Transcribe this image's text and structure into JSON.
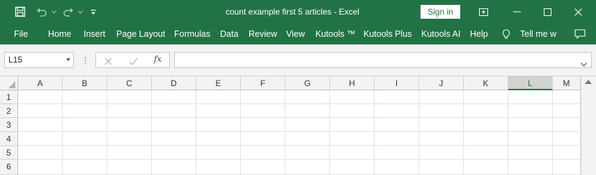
{
  "window": {
    "title": "count example first 5 articles  -  Excel",
    "sign_in_label": "Sign in",
    "icons": [
      "save-icon",
      "undo-icon",
      "redo-icon",
      "customize-qat-icon",
      "ribbon-display-icon",
      "minimize-icon",
      "maximize-icon",
      "close-icon"
    ]
  },
  "ribbon": {
    "tabs": [
      "File",
      "Home",
      "Insert",
      "Page Layout",
      "Formulas",
      "Data",
      "Review",
      "View",
      "Kutools ™",
      "Kutools Plus",
      "Kutools AI",
      "Help"
    ],
    "tell_me": "Tell me w",
    "icons": [
      "lightbulb-icon",
      "comment-icon"
    ]
  },
  "formula_bar": {
    "name_box": "L15",
    "formula_value": "",
    "fx_symbol": "fx",
    "icons": [
      "cancel-icon",
      "enter-icon",
      "insert-function-icon",
      "expand-formula-icon"
    ]
  },
  "sheet": {
    "columns": [
      "A",
      "B",
      "C",
      "D",
      "E",
      "F",
      "G",
      "H",
      "I",
      "J",
      "K",
      "L",
      "M"
    ],
    "selected_column": "L",
    "rows": [
      "1",
      "2",
      "3",
      "4",
      "5",
      "6"
    ]
  },
  "colors": {
    "accent": "#217346",
    "header_bg": "#f3f3f3",
    "selected_header_bg": "#d2d2d2"
  }
}
